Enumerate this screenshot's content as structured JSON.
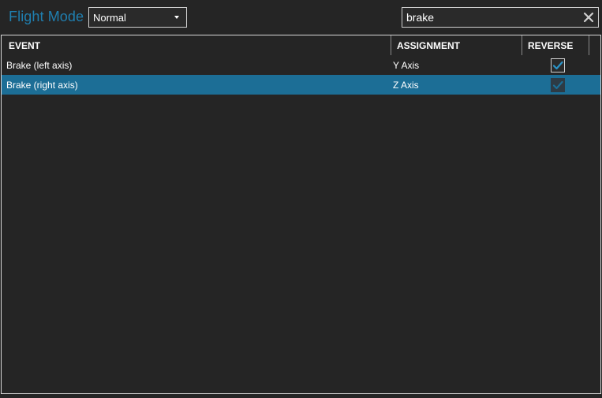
{
  "header": {
    "title": "Flight Mode",
    "mode_selected": "Normal",
    "search_value": "brake"
  },
  "grid": {
    "columns": [
      "EVENT",
      "ASSIGNMENT",
      "REVERSE"
    ],
    "rows": [
      {
        "event": "Brake (left axis)",
        "assignment": "Y Axis",
        "reverse": true,
        "selected": false
      },
      {
        "event": "Brake (right axis)",
        "assignment": "Z Axis",
        "reverse": true,
        "selected": true
      }
    ]
  },
  "colors": {
    "accent": "#1f7fb0",
    "selected_row": "#1c6e96",
    "background": "#252525"
  }
}
